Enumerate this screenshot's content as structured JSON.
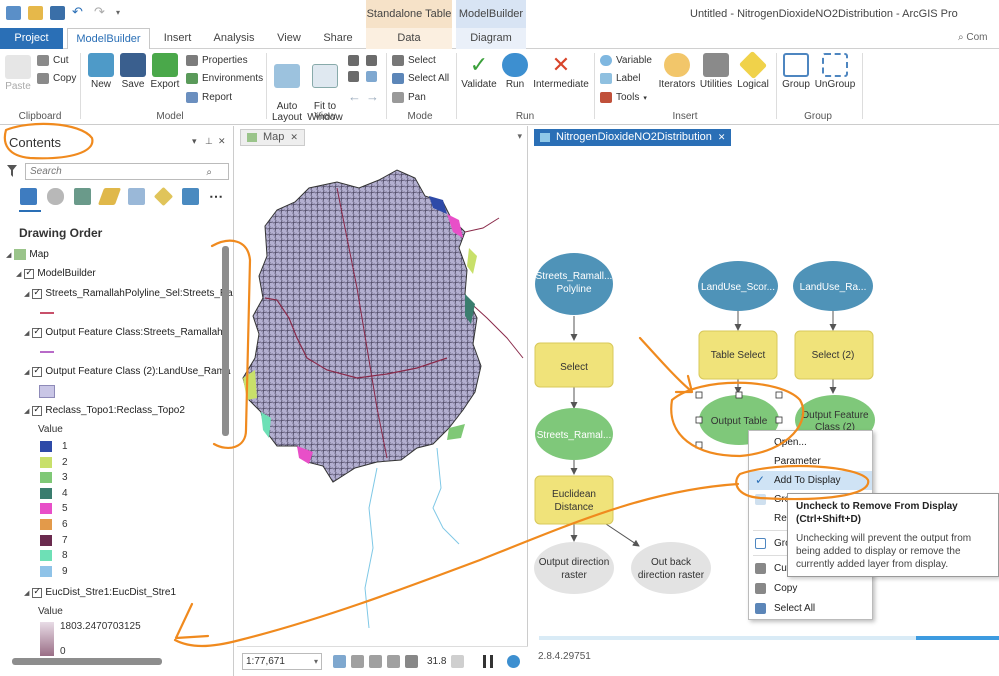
{
  "window": {
    "title": "Untitled - NitrogenDioxideNO2Distribution - ArcGIS Pro",
    "contextual_tab_a": "Standalone Table",
    "contextual_tab_b": "ModelBuilder",
    "search": "Com"
  },
  "tabs": [
    "Project",
    "ModelBuilder",
    "Insert",
    "Analysis",
    "View",
    "Share",
    "Data",
    "Diagram"
  ],
  "ribbon": {
    "clipboard": {
      "label": "Clipboard",
      "paste": "Paste",
      "cut": "Cut",
      "copy": "Copy"
    },
    "model": {
      "label": "Model",
      "new": "New",
      "save": "Save",
      "export": "Export",
      "properties": "Properties",
      "environments": "Environments",
      "report": "Report"
    },
    "view": {
      "label": "View",
      "auto_layout": "Auto\nLayout",
      "fit_to_window": "Fit to\nWindow"
    },
    "mode": {
      "label": "Mode",
      "select": "Select",
      "select_all": "Select All",
      "pan": "Pan"
    },
    "run": {
      "label": "Run",
      "validate": "Validate",
      "run": "Run",
      "intermediate": "Intermediate"
    },
    "insert": {
      "label": "Insert",
      "variable": "Variable",
      "label_btn": "Label",
      "tools": "Tools",
      "iterators": "Iterators",
      "utilities": "Utilities",
      "logical": "Logical"
    },
    "group": {
      "label": "Group",
      "group": "Group",
      "ungroup": "UnGroup"
    }
  },
  "contents": {
    "title": "Contents",
    "search_placeholder": "Search",
    "drawing_order": "Drawing Order",
    "tree": {
      "map": "Map",
      "modelbuilder": "ModelBuilder",
      "layer1": "Streets_RamallahPolyline_Sel:Streets_Ra",
      "layer2": "Output Feature Class:Streets_RamallahP",
      "layer3": "Output Feature Class (2):LandUse_Rama",
      "layer4": "Reclass_Topo1:Reclass_Topo2",
      "value_label": "Value",
      "layer5": "EucDist_Stre1:EucDist_Stre1",
      "value_label2": "Value",
      "ramp_high": "1803.2470703125",
      "ramp_low": "0"
    },
    "legend": [
      {
        "label": "1",
        "color": "#2e4aa8"
      },
      {
        "label": "2",
        "color": "#c8e06a"
      },
      {
        "label": "3",
        "color": "#7fc876"
      },
      {
        "label": "4",
        "color": "#3a7d6e"
      },
      {
        "label": "5",
        "color": "#e84fc8"
      },
      {
        "label": "6",
        "color": "#e39a4a"
      },
      {
        "label": "7",
        "color": "#6a2a4e"
      },
      {
        "label": "8",
        "color": "#6ee0b6"
      },
      {
        "label": "9",
        "color": "#8fc3e8"
      }
    ]
  },
  "map_pane": {
    "tab": "Map",
    "scale": "1:77,671",
    "status_num": "31.8"
  },
  "diagram_pane": {
    "tab": "NitrogenDioxideNO2Distribution",
    "status": "2.8.4.29751",
    "nodes": {
      "streets_polyline": "Streets_Ramall...\nPolyline",
      "select": "Select",
      "streets_ramal": "Streets_Ramal...",
      "euclidean": "Euclidean\nDistance",
      "out_dir": "Output direction\nraster",
      "out_back": "Out back\ndirection raster",
      "landuse_scor": "LandUse_Scor...",
      "landuse_ra": "LandUse_Ra...",
      "table_select": "Table Select",
      "select2": "Select (2)",
      "output_table": "Output Table",
      "output_fc2": "Output Feature\nClass (2)"
    }
  },
  "context_menu": {
    "items": [
      "Open...",
      "Parameter",
      "Add To Display",
      "Create Label",
      "Rename",
      "Group",
      "Cut",
      "Copy",
      "Select All"
    ]
  },
  "tooltip": {
    "title": "Uncheck to Remove From Display (Ctrl+Shift+D)",
    "body": "Unchecking will prevent the output from being added to display or remove the currently added layer from display."
  },
  "colors": {
    "accent": "#2a6fb6",
    "data_node": "#4f93b8",
    "tool_node": "#f0e37a",
    "derived_node": "#7fc87a",
    "annotation": "#f08a1e"
  }
}
